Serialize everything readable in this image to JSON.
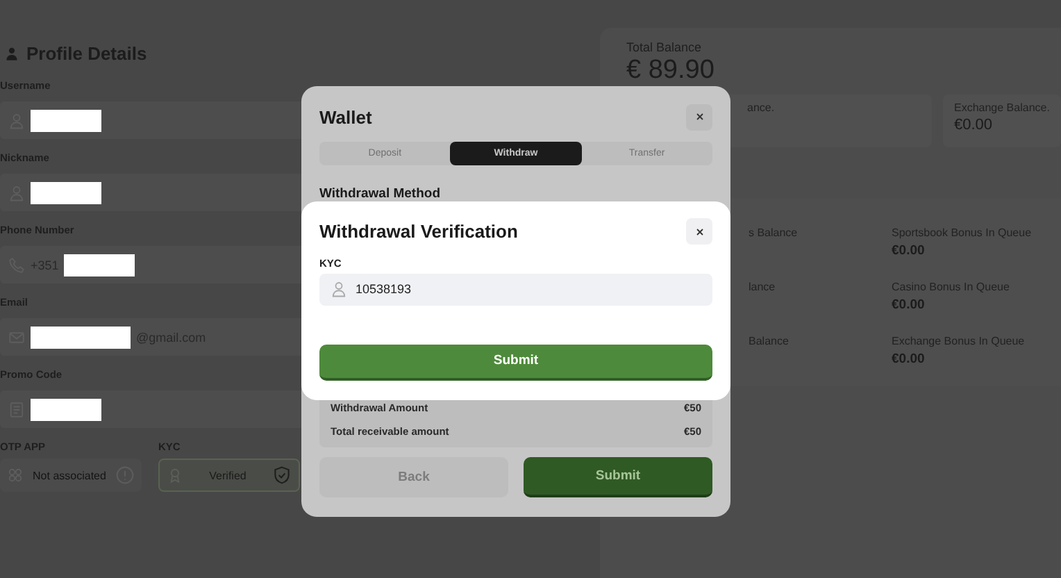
{
  "profile": {
    "title": "Profile Details",
    "fields": [
      {
        "label": "Username",
        "kind": "person"
      },
      {
        "label": "Nickname",
        "kind": "person"
      },
      {
        "label": "Phone Number",
        "kind": "phone",
        "prefix": "+351"
      },
      {
        "label": "Email",
        "kind": "mail",
        "suffix": "@gmail.com"
      },
      {
        "label": "Promo Code",
        "kind": "ticket"
      }
    ],
    "statuses": [
      {
        "label": "OTP APP",
        "value": "Not associated",
        "verified": false
      },
      {
        "label": "KYC",
        "value": "Verified",
        "verified": true
      }
    ]
  },
  "balance": {
    "label": "Total Balance",
    "amount": "€ 89.90",
    "cards": [
      {
        "label": "ance."
      },
      {
        "label": "Exchange Balance.",
        "amount": "€0.00"
      }
    ],
    "rows": [
      {
        "left_label": "s Balance",
        "label": "Sportsbook Bonus In Queue",
        "amount": "€0.00"
      },
      {
        "left_label": "lance",
        "label": "Casino Bonus In Queue",
        "amount": "€0.00"
      },
      {
        "left_label": "Balance",
        "label": "Exchange Bonus In Queue",
        "amount": "€0.00"
      }
    ]
  },
  "wallet": {
    "title": "Wallet",
    "tabs": [
      {
        "label": "Deposit",
        "selected": false
      },
      {
        "label": "Withdraw",
        "selected": true
      },
      {
        "label": "Transfer",
        "selected": false
      }
    ],
    "method_heading": "Withdrawal Method",
    "summary": [
      {
        "label": "Withdrawal Amount",
        "value": "€50"
      },
      {
        "label": "Total receivable amount",
        "value": "€50"
      }
    ],
    "buttons": [
      {
        "label": "Back",
        "kind": "secondary"
      },
      {
        "label": "Submit",
        "kind": "primary"
      }
    ]
  },
  "verification": {
    "title": "Withdrawal Verification",
    "field_label": "KYC",
    "value": "10538193",
    "button": "Submit"
  }
}
